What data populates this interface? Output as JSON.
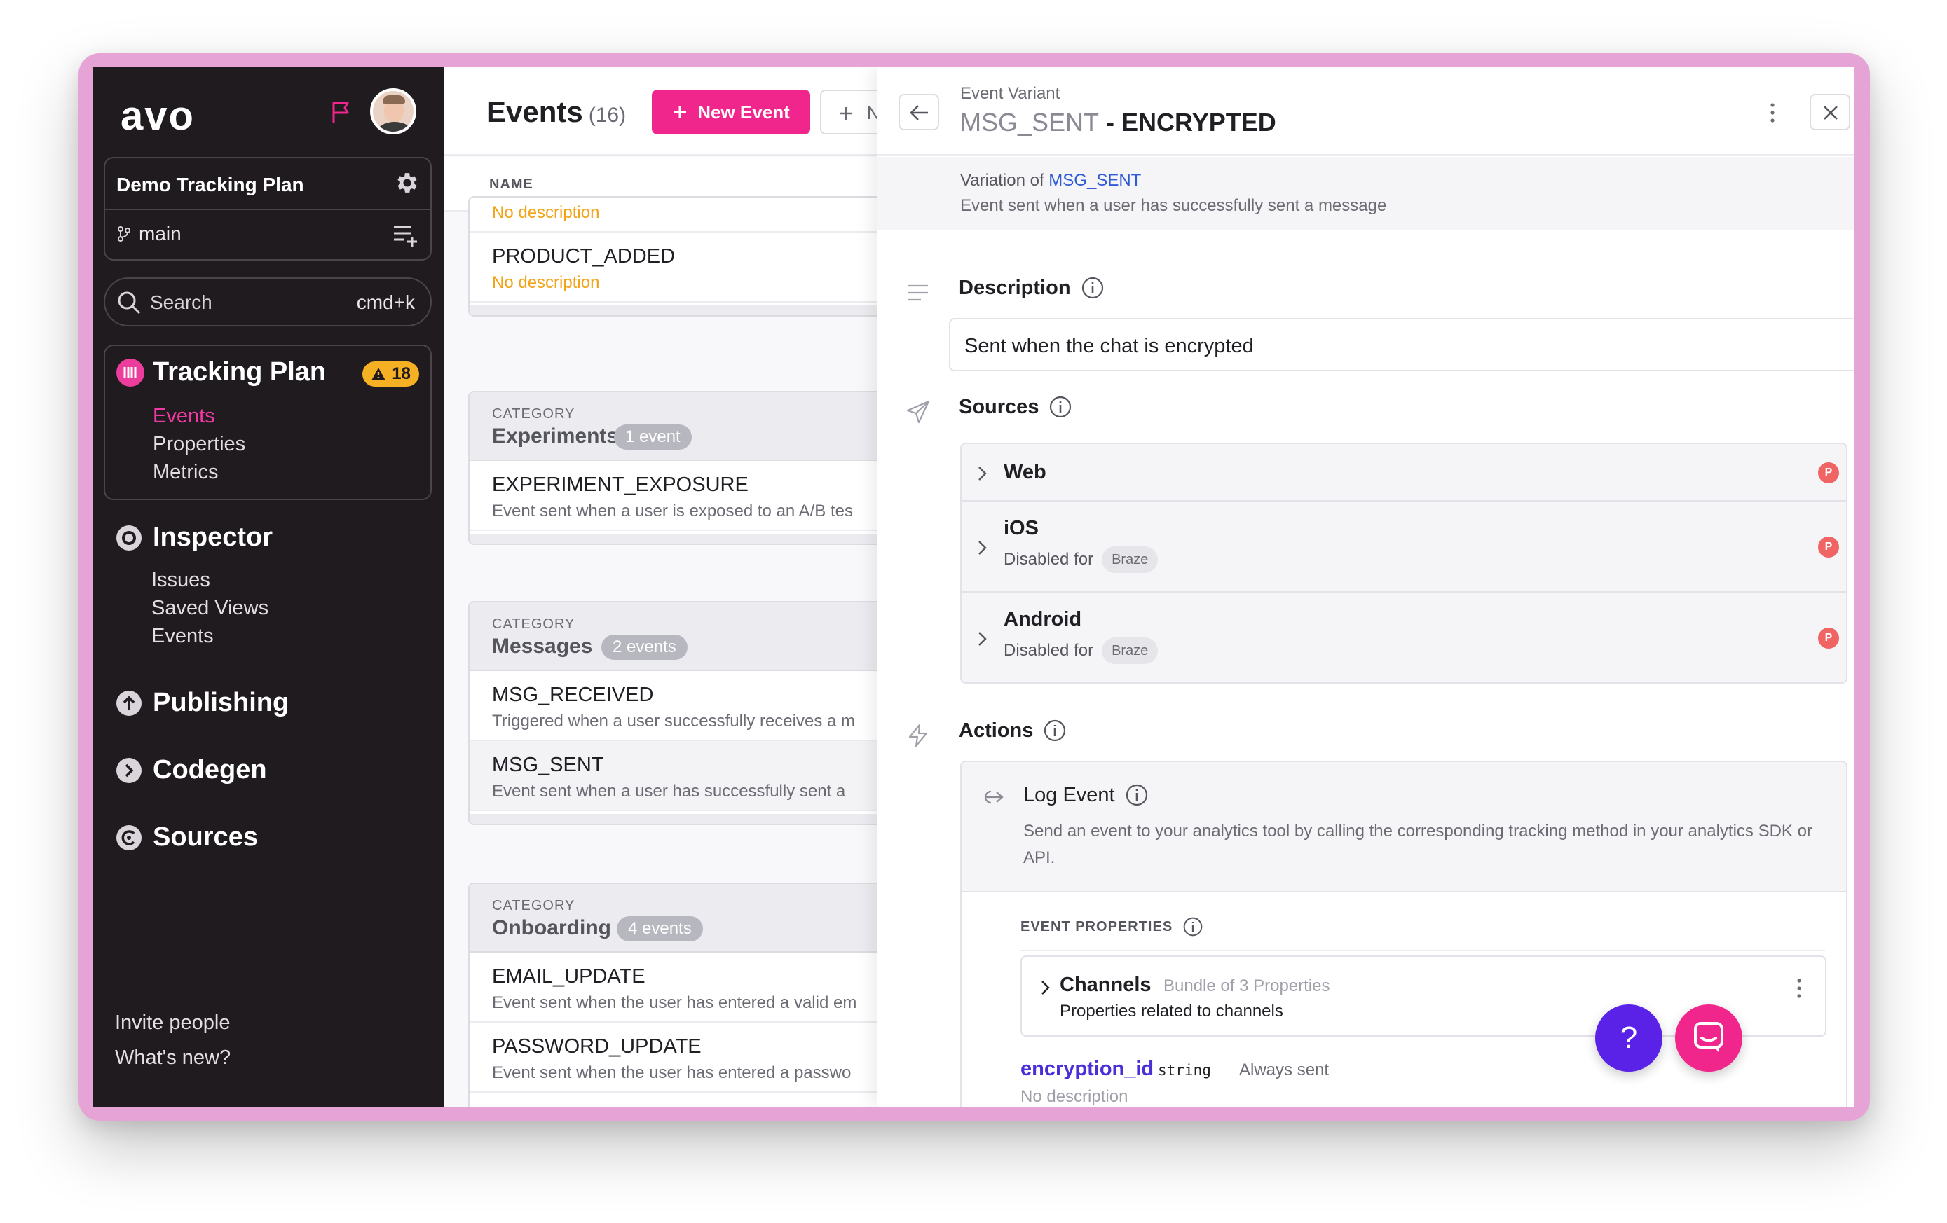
{
  "sidebar": {
    "logo": "avo",
    "workspace": {
      "name": "Demo Tracking Plan",
      "branch": "main"
    },
    "search": {
      "label": "Search",
      "shortcut": "cmd+k"
    },
    "tracking_plan": {
      "title": "Tracking Plan",
      "warning_count": "18",
      "items": [
        {
          "label": "Events",
          "active": true
        },
        {
          "label": "Properties",
          "active": false
        },
        {
          "label": "Metrics",
          "active": false
        }
      ]
    },
    "inspector": {
      "title": "Inspector",
      "items": [
        {
          "label": "Issues"
        },
        {
          "label": "Saved Views"
        },
        {
          "label": "Events"
        }
      ]
    },
    "publishing": {
      "title": "Publishing"
    },
    "codegen": {
      "title": "Codegen"
    },
    "sources": {
      "title": "Sources"
    },
    "footer": {
      "invite": "Invite people",
      "whats_new": "What's new?"
    }
  },
  "events_pane": {
    "title": "Events",
    "count": "(16)",
    "new_event_label": "New Event",
    "second_btn_label": "N",
    "column_name": "NAME",
    "top_card": [
      {
        "name": "",
        "description": "No description"
      },
      {
        "name": "PRODUCT_ADDED",
        "description": "No description"
      }
    ],
    "category_label": "CATEGORY",
    "categories": [
      {
        "name": "Experiments",
        "badge": "1 event",
        "events": [
          {
            "name": "EXPERIMENT_EXPOSURE",
            "description": "Event sent when a user is exposed to an A/B tes"
          }
        ]
      },
      {
        "name": "Messages",
        "badge": "2 events",
        "events": [
          {
            "name": "MSG_RECEIVED",
            "description": "Triggered when a user successfully receives a m"
          },
          {
            "name": "MSG_SENT",
            "description": "Event sent when a user has successfully sent a"
          }
        ]
      },
      {
        "name": "Onboarding",
        "badge": "4 events",
        "events": [
          {
            "name": "EMAIL_UPDATE",
            "description": "Event sent when the user has entered a valid em"
          },
          {
            "name": "PASSWORD_UPDATE",
            "description": "Event sent when the user has entered a passwo"
          }
        ]
      }
    ]
  },
  "detail": {
    "kind": "Event Variant",
    "title_base": "MSG_SENT",
    "title_variant": " - ENCRYPTED",
    "variation_of_label": "Variation of ",
    "variation_of_link": "MSG_SENT",
    "variation_description": "Event sent when a user has successfully sent a message",
    "description_heading": "Description",
    "description_value": "Sent when the chat is encrypted",
    "sources_heading": "Sources",
    "sources": [
      {
        "name": "Web",
        "disabled_label": "",
        "disabled_chip": "",
        "badge": "P"
      },
      {
        "name": "iOS",
        "disabled_label": "Disabled for",
        "disabled_chip": "Braze",
        "badge": "P"
      },
      {
        "name": "Android",
        "disabled_label": "Disabled for",
        "disabled_chip": "Braze",
        "badge": "P"
      }
    ],
    "actions_heading": "Actions",
    "log_event": {
      "title": "Log Event",
      "description": "Send an event to your analytics tool by calling the corresponding tracking method in your analytics SDK or API."
    },
    "event_properties_label": "EVENT PROPERTIES",
    "bundle": {
      "name": "Channels",
      "meta": "Bundle of 3 Properties",
      "description": "Properties related to channels"
    },
    "property": {
      "name": "encryption_id",
      "type": "string",
      "presence": "Always sent",
      "description": "No description"
    }
  },
  "floating": {
    "help_label": "?"
  },
  "colors": {
    "accent_pink": "#f0268c",
    "link_blue": "#2f5bd8",
    "warning_yellow": "#f6b024",
    "help_purple": "#5a21e6",
    "sidebar_bg": "#1f1b1e",
    "frame_pink": "#e6a3d6"
  },
  "icons": [
    "flag-icon",
    "gear-icon",
    "branch-icon",
    "list-add-icon",
    "search-icon",
    "tracking-plan-icon",
    "warning-icon",
    "inspector-icon",
    "publishing-icon",
    "codegen-icon",
    "sources-icon",
    "plus-icon",
    "arrow-left-icon",
    "kebab-icon",
    "close-icon",
    "lines-icon",
    "info-icon",
    "send-icon",
    "bolt-icon",
    "chevron-right-icon",
    "log-event-icon",
    "chat-icon"
  ]
}
